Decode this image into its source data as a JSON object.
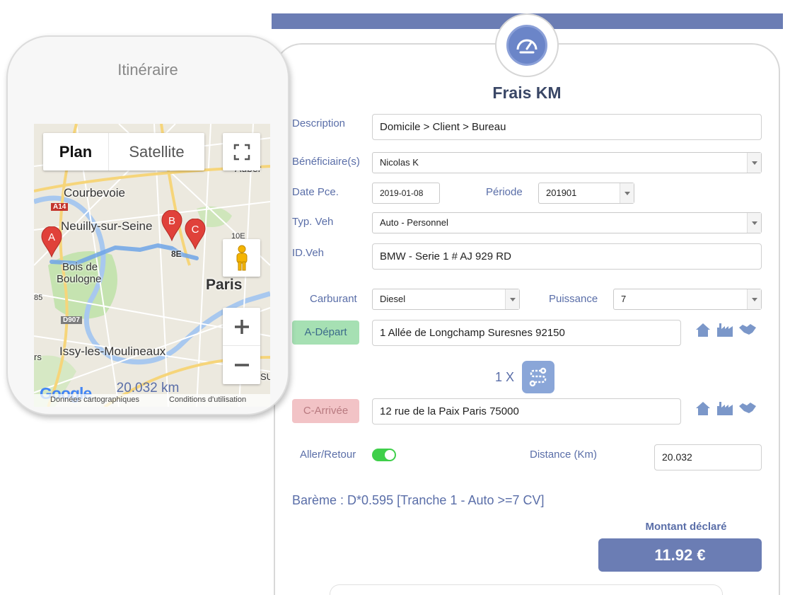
{
  "form": {
    "title": "Frais KM",
    "logo_icon": "speedometer-icon",
    "description": {
      "label": "Description",
      "value": "Domicile > Client > Bureau"
    },
    "beneficiaires": {
      "label": "Bénéficiaire(s)",
      "value": "Nicolas K"
    },
    "date_pce": {
      "label": "Date Pce.",
      "value": "2019-01-08"
    },
    "periode": {
      "label": "Période",
      "value": "201901"
    },
    "typ_veh": {
      "label": "Typ. Veh",
      "value": "Auto - Personnel"
    },
    "id_veh": {
      "label": "ID.Veh",
      "value": "BMW - Serie 1 # AJ 929 RD"
    },
    "carburant": {
      "label": "Carburant",
      "value": "Diesel"
    },
    "puissance": {
      "label": "Puissance",
      "value": "7"
    },
    "depart": {
      "label": "A-Départ",
      "value": "1 Allée de Longchamp Suresnes 92150"
    },
    "arrivee": {
      "label": "C-Arrivée",
      "value": "12 rue de la Paix Paris 75000"
    },
    "address_icons": [
      "home-icon",
      "factory-icon",
      "handshake-icon"
    ],
    "swap": {
      "count": "1 X",
      "icon": "route-swap-icon"
    },
    "aller_retour": {
      "label": "Aller/Retour",
      "enabled": true
    },
    "distance": {
      "label": "Distance (Km)",
      "value": "20.032"
    },
    "bareme": "Barème : D*0.595 [Tranche 1 - Auto >=7 CV]",
    "montant": {
      "label": "Montant déclaré",
      "value": "11.92 €"
    }
  },
  "map_panel": {
    "title": "Itinéraire",
    "distance": "20.032 km",
    "map_type": {
      "plan": "Plan",
      "satellite": "Satellite"
    },
    "places": {
      "courbevoie": "Courbevoie",
      "neuilly": "Neuilly-sur-Seine",
      "bois1": "Bois de",
      "bois2": "Boulogne",
      "paris": "Paris",
      "issy": "Issy-les-Moulineaux",
      "auber": "Auber",
      "e8": "8E",
      "e10": "10E",
      "su": "SU",
      "e85": "85",
      "rs": "rs"
    },
    "roads": {
      "a14": "A14",
      "d907": "D907"
    },
    "markers": [
      "A",
      "B",
      "C"
    ],
    "footer": {
      "data": "Données cartographiques",
      "terms": "Conditions d'utilisation"
    },
    "google": "Google",
    "colors": {
      "route": "#6fa5e8",
      "marker": "#e0413a"
    }
  }
}
